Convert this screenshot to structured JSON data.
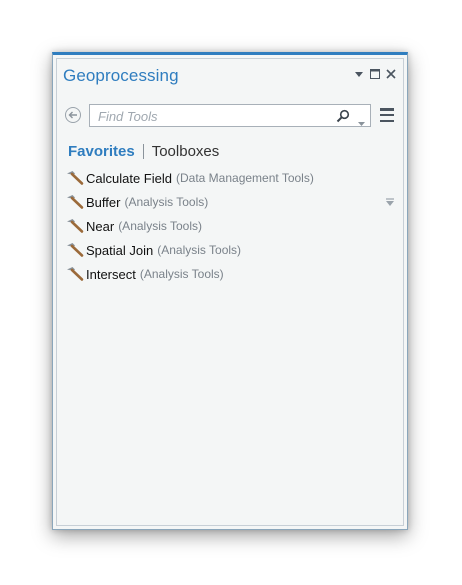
{
  "pane": {
    "title": "Geoprocessing",
    "accent": "#2f7dbf"
  },
  "search": {
    "placeholder": "Find Tools",
    "value": ""
  },
  "tabs": [
    {
      "label": "Favorites",
      "active": true
    },
    {
      "label": "Toolboxes",
      "active": false
    }
  ],
  "tools": [
    {
      "name": "Calculate Field",
      "toolbox": "(Data Management Tools)"
    },
    {
      "name": "Buffer",
      "toolbox": "(Analysis Tools)"
    },
    {
      "name": "Near",
      "toolbox": "(Analysis Tools)"
    },
    {
      "name": "Spatial Join",
      "toolbox": "(Analysis Tools)"
    },
    {
      "name": "Intersect",
      "toolbox": "(Analysis Tools)"
    }
  ],
  "icons": {
    "tool": "hammer-icon",
    "back": "back-arrow-icon",
    "search": "search-icon",
    "menu": "menu-icon",
    "pin": "pin-icon"
  }
}
